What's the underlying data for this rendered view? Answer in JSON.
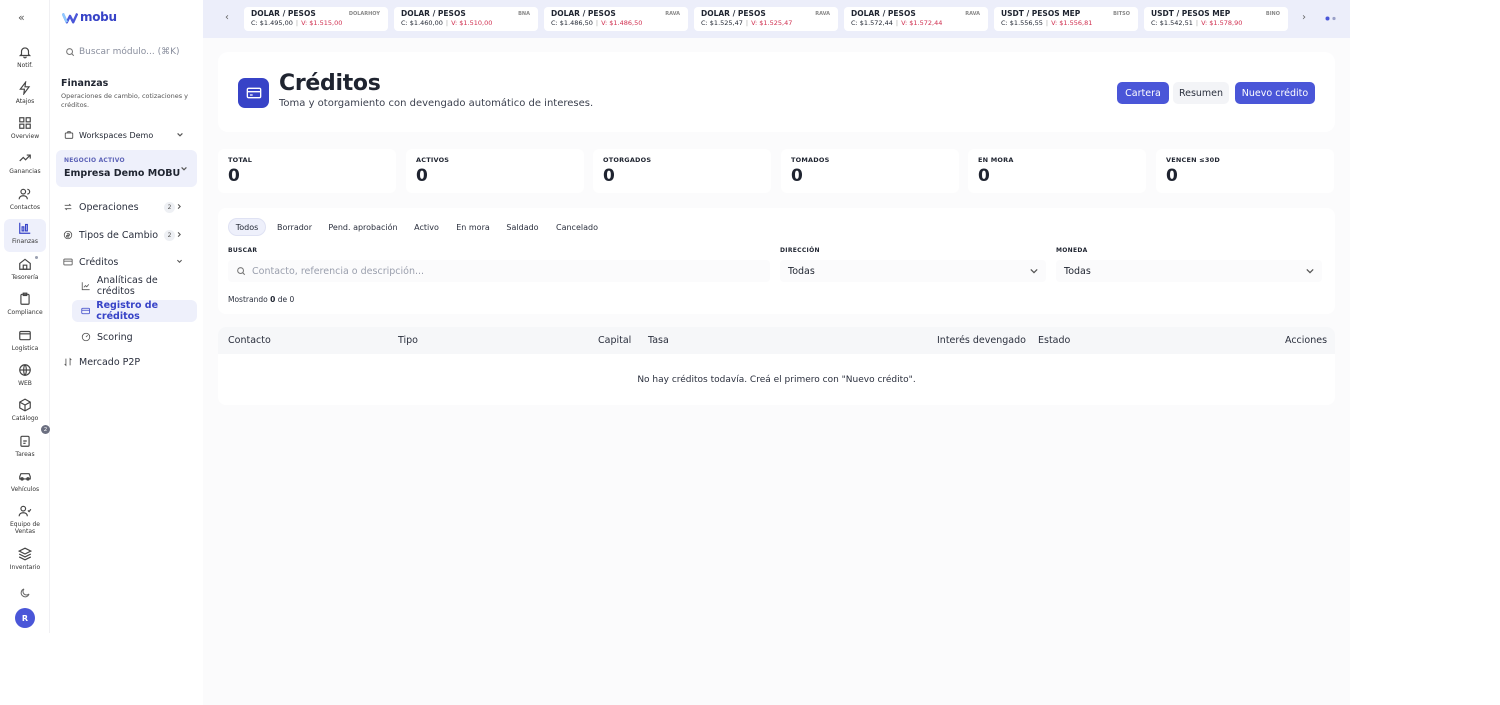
{
  "app": {
    "logo_text": "mobu"
  },
  "rail": {
    "items": [
      {
        "label": "Notif.",
        "icon": "bell-icon"
      },
      {
        "label": "Atajos",
        "icon": "zap-icon"
      },
      {
        "label": "Overview",
        "icon": "grid-icon"
      },
      {
        "label": "Ganancias",
        "icon": "trend-icon"
      },
      {
        "label": "Contactos",
        "icon": "users-icon"
      },
      {
        "label": "Finanzas",
        "icon": "finance-icon"
      },
      {
        "label": "Tesorería",
        "icon": "home-icon"
      },
      {
        "label": "Compliance",
        "icon": "clipboard-icon"
      },
      {
        "label": "Logística",
        "icon": "box-icon"
      },
      {
        "label": "WEB",
        "icon": "globe-icon"
      },
      {
        "label": "Catálogo",
        "icon": "package-icon"
      },
      {
        "label": "Tareas",
        "icon": "task-icon"
      },
      {
        "label": "Vehículos",
        "icon": "car-icon"
      },
      {
        "label": "Equipo de Ventas",
        "icon": "team-icon"
      },
      {
        "label": "Inventario",
        "icon": "layers-icon"
      }
    ],
    "catalog_badge": "2",
    "avatar": "R"
  },
  "sidebar": {
    "search_placeholder": "Buscar módulo... (⌘K)",
    "module_title": "Finanzas",
    "module_desc": "Operaciones de cambio, cotizaciones y créditos.",
    "workspace": "Workspaces Demo",
    "business_label": "NEGOCIO ACTIVO",
    "business_name": "Empresa Demo MOBU",
    "nav": [
      {
        "label": "Operaciones",
        "count": "2"
      },
      {
        "label": "Tipos de Cambio",
        "count": "2"
      },
      {
        "label": "Créditos"
      }
    ],
    "sub": [
      {
        "label": "Analíticas de créditos"
      },
      {
        "label": "Registro de créditos"
      },
      {
        "label": "Scoring"
      }
    ],
    "p2p": "Mercado P2P"
  },
  "ticker": [
    {
      "pair": "DOLAR / PESOS",
      "source": "DOLARHOY",
      "c": "C: $1.495,00",
      "v": "V: $1.515,00"
    },
    {
      "pair": "DOLAR / PESOS",
      "source": "BNA",
      "c": "C: $1.460,00",
      "v": "V: $1.510,00"
    },
    {
      "pair": "DOLAR / PESOS",
      "source": "RAVA",
      "c": "C: $1.486,50",
      "v": "V: $1.486,50"
    },
    {
      "pair": "DOLAR / PESOS",
      "source": "RAVA",
      "c": "C: $1.525,47",
      "v": "V: $1.525,47"
    },
    {
      "pair": "DOLAR / PESOS",
      "source": "RAVA",
      "c": "C: $1.572,44",
      "v": "V: $1.572,44"
    },
    {
      "pair": "USDT / PESOS MEP",
      "source": "BITSO",
      "c": "C: $1.556,55",
      "v": "V: $1.556,81"
    },
    {
      "pair": "USDT / PESOS MEP",
      "source": "BINO",
      "c": "C: $1.542,51",
      "v": "V: $1.578,90"
    }
  ],
  "header": {
    "title": "Créditos",
    "subtitle": "Toma y otorgamiento con devengado automático de intereses.",
    "btn_cartera": "Cartera",
    "btn_resumen": "Resumen",
    "btn_nuevo": "Nuevo crédito"
  },
  "kpis": [
    {
      "label": "TOTAL",
      "value": "0"
    },
    {
      "label": "ACTIVOS",
      "value": "0"
    },
    {
      "label": "OTORGADOS",
      "value": "0"
    },
    {
      "label": "TOMADOS",
      "value": "0"
    },
    {
      "label": "EN MORA",
      "value": "0"
    },
    {
      "label": "VENCEN ≤30D",
      "value": "0"
    }
  ],
  "filters": {
    "tabs": [
      "Todos",
      "Borrador",
      "Pend. aprobación",
      "Activo",
      "En mora",
      "Saldado",
      "Cancelado"
    ],
    "search_label": "BUSCAR",
    "search_placeholder": "Contacto, referencia o descripción...",
    "direction_label": "DIRECCIÓN",
    "direction_value": "Todas",
    "currency_label": "MONEDA",
    "currency_value": "Todas",
    "count_prefix": "Mostrando",
    "count_shown": "0",
    "count_mid": "de",
    "count_total": "0"
  },
  "table": {
    "columns": [
      "Contacto",
      "Tipo",
      "Capital",
      "Tasa",
      "Interés devengado",
      "Estado",
      "Acciones"
    ],
    "empty": "No hay créditos todavía. Creá el primero con \"Nuevo crédito\"."
  },
  "colors": {
    "accent": "#4a56d8",
    "ticker_bg": "#eceefa",
    "sell_value": "#d03050"
  }
}
